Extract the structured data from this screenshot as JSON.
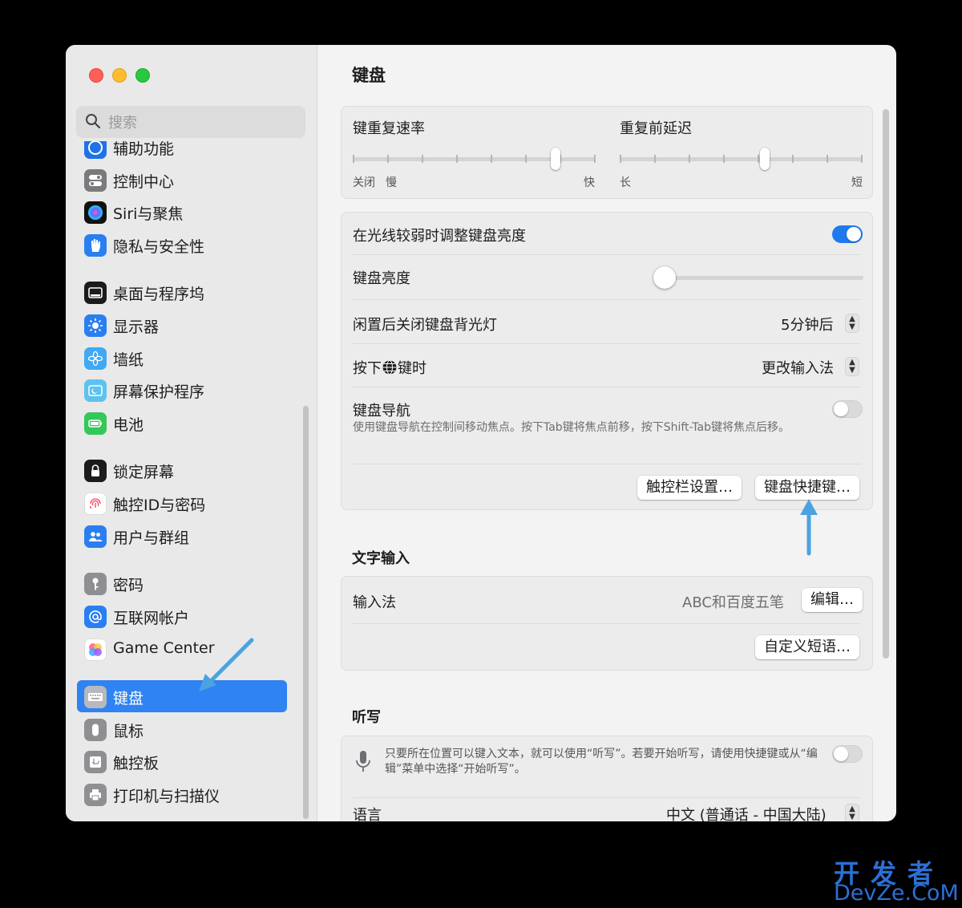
{
  "window": {
    "accent": "#2f83f2"
  },
  "sidebar": {
    "search_placeholder": "搜索",
    "items": [
      {
        "label": "辅助功能",
        "icon": "accessibility-icon"
      },
      {
        "label": "控制中心",
        "icon": "control-center-icon"
      },
      {
        "label": "Siri与聚焦",
        "icon": "siri-icon"
      },
      {
        "label": "隐私与安全性",
        "icon": "hand-icon"
      },
      {
        "label": "桌面与程序坞",
        "icon": "dock-icon"
      },
      {
        "label": "显示器",
        "icon": "sun-icon"
      },
      {
        "label": "墙纸",
        "icon": "flower-icon"
      },
      {
        "label": "屏幕保护程序",
        "icon": "screensaver-icon"
      },
      {
        "label": "电池",
        "icon": "battery-icon"
      },
      {
        "label": "锁定屏幕",
        "icon": "lock-icon"
      },
      {
        "label": "触控ID与密码",
        "icon": "fingerprint-icon"
      },
      {
        "label": "用户与群组",
        "icon": "users-icon"
      },
      {
        "label": "密码",
        "icon": "key-icon"
      },
      {
        "label": "互联网帐户",
        "icon": "at-icon"
      },
      {
        "label": "Game Center",
        "icon": "game-center-icon"
      },
      {
        "label": "键盘",
        "icon": "keyboard-icon",
        "selected": true
      },
      {
        "label": "鼠标",
        "icon": "mouse-icon"
      },
      {
        "label": "触控板",
        "icon": "trackpad-icon"
      },
      {
        "label": "打印机与扫描仪",
        "icon": "printer-icon"
      }
    ]
  },
  "main": {
    "title": "键盘",
    "repeat": {
      "rate_label": "键重复速率",
      "rate_ticks": [
        "关闭",
        "慢",
        "快"
      ],
      "rate_value": 0.85,
      "delay_label": "重复前延迟",
      "delay_ticks": [
        "长",
        "短"
      ],
      "delay_value": 0.6
    },
    "settings": {
      "adjust_brightness_label": "在光线较弱时调整键盘亮度",
      "adjust_brightness_on": true,
      "brightness_label": "键盘亮度",
      "brightness_value": 0.0,
      "backlight_off_label": "闲置后关闭键盘背光灯",
      "backlight_off_value": "5分钟后",
      "globe_prefix": "按下",
      "globe_suffix": "键时",
      "globe_value": "更改输入法",
      "nav_label": "键盘导航",
      "nav_desc": "使用键盘导航在控制间移动焦点。按下Tab键将焦点前移，按下Shift-Tab键将焦点后移。",
      "nav_on": false,
      "touchbar_button": "触控栏设置…",
      "shortcuts_button": "键盘快捷键…"
    },
    "text_input": {
      "section_title": "文字输入",
      "input_label": "输入法",
      "input_value": "ABC和百度五笔",
      "edit_button": "编辑…",
      "phrases_button": "自定义短语…"
    },
    "dictation": {
      "section_title": "听写",
      "desc": "只要所在位置可以键入文本，就可以使用“听写”。若要开始听写，请使用快捷键或从“编辑”菜单中选择“开始听写”。",
      "on": false,
      "language_label": "语言",
      "language_value": "中文 (普通话 - 中国大陆)"
    }
  },
  "watermark": {
    "line1": "开发者",
    "line2": "DevZe.CoM"
  }
}
